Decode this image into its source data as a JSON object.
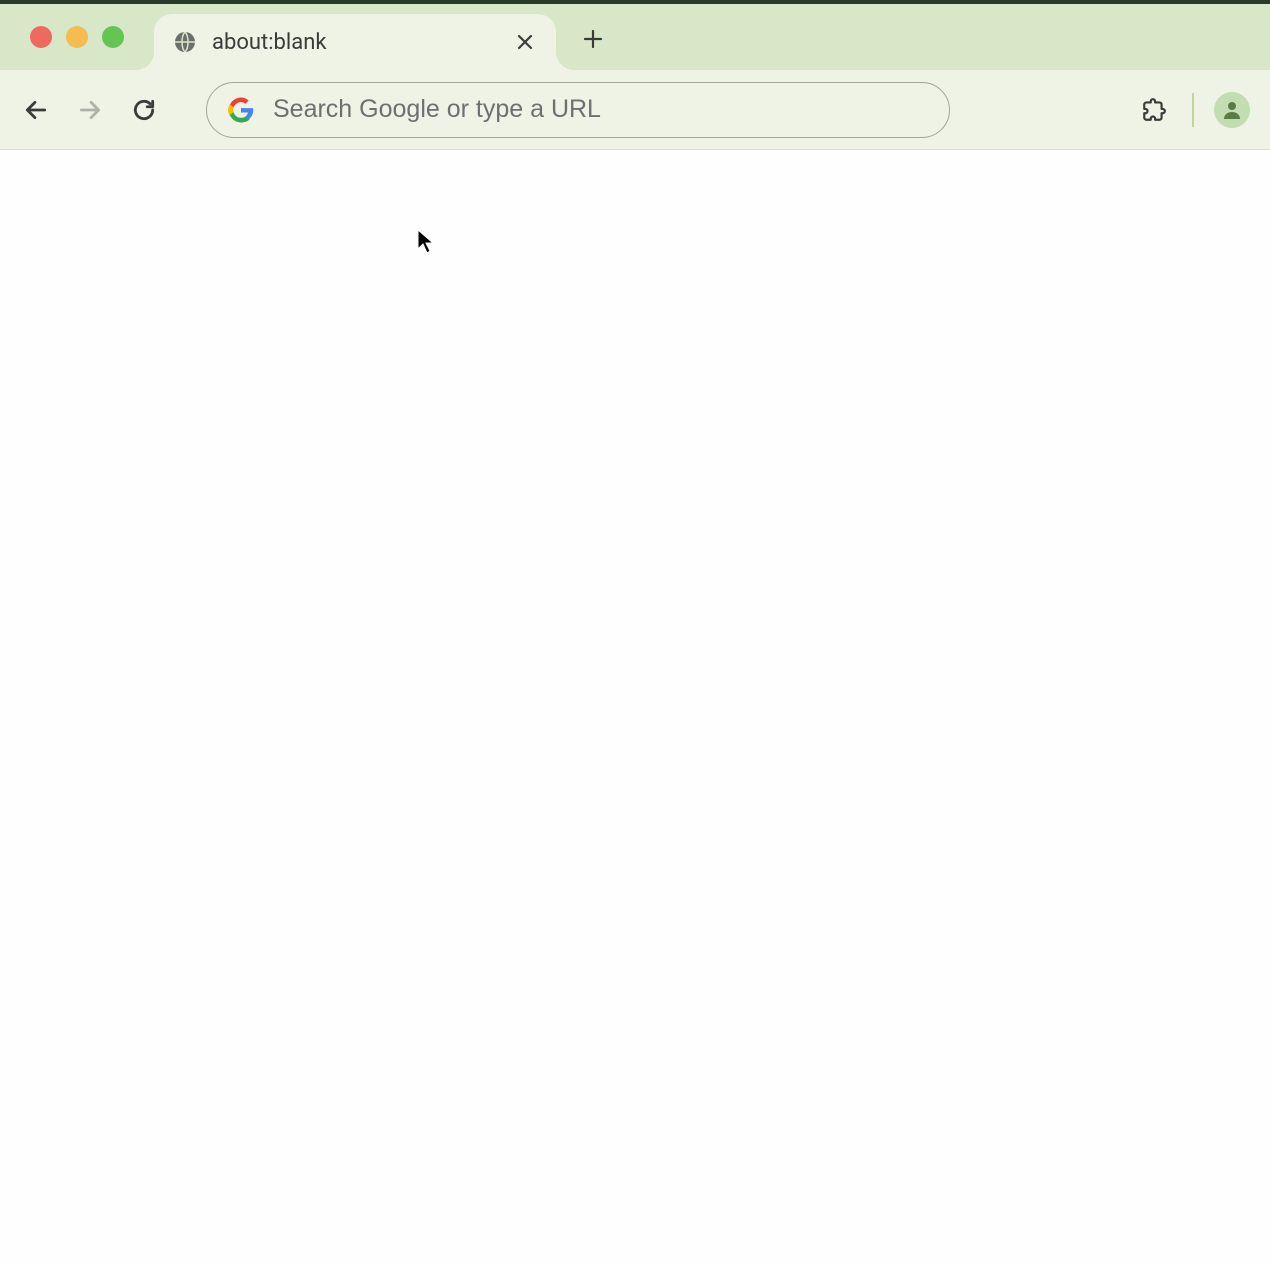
{
  "tab": {
    "title": "about:blank"
  },
  "omnibox": {
    "placeholder": "Search Google or type a URL",
    "value": ""
  },
  "colors": {
    "tabStrip": "#d7e7c7",
    "toolbar": "#eef3e5",
    "trafficClose": "#ee6a5f",
    "trafficMin": "#f5bd4f",
    "trafficMax": "#62c554"
  }
}
